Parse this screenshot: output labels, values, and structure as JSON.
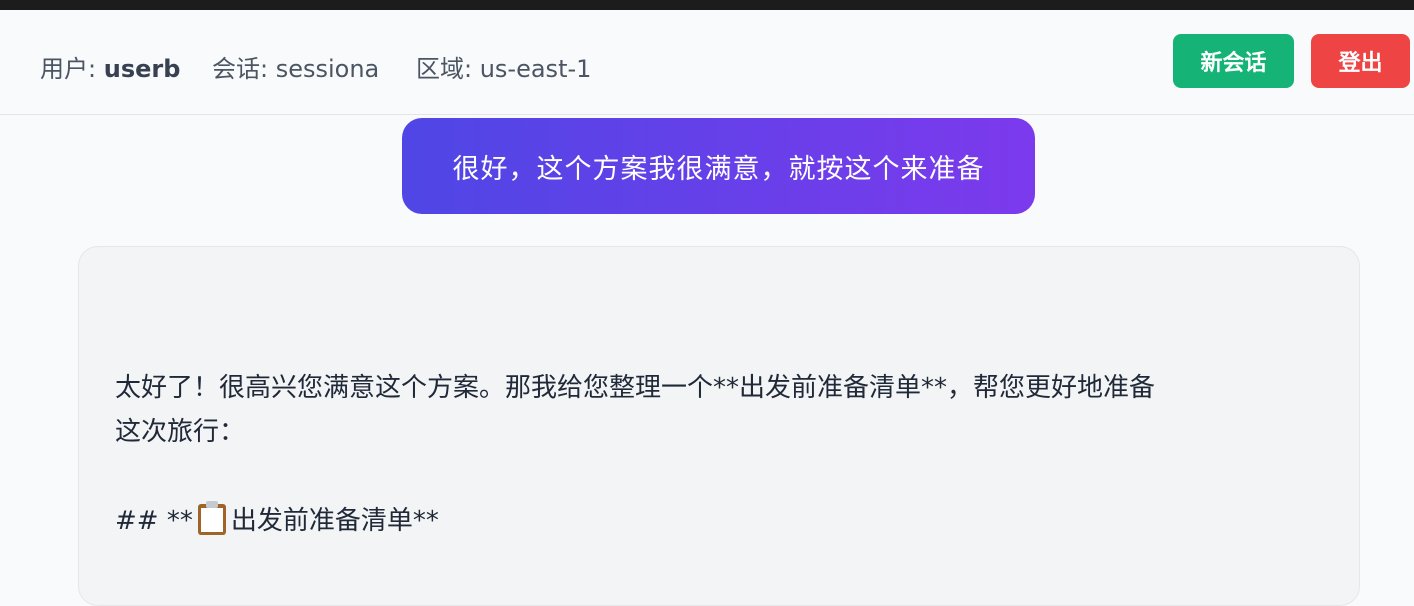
{
  "header": {
    "user_label": "用户:",
    "user_value": "userb",
    "session_text": "会话: sessiona",
    "region_text": "区域: us-east-1",
    "new_session_label": "新会话",
    "logout_label": "登出"
  },
  "colors": {
    "new_session_button": "#16b377",
    "logout_button": "#ef4444",
    "user_bubble_gradient_start": "#4f46e5",
    "user_bubble_gradient_end": "#7c3aed"
  },
  "chat": {
    "user_message": "很好，这个方案我很满意，就按这个来准备",
    "assistant_lines": [
      "太好了！很高兴您满意这个方案。那我给您整理一个**出发前准备清单**，帮您更好地准备",
      "这次旅行：",
      "## **",
      "出发前准备清单**"
    ],
    "assistant_icon": "clipboard-icon"
  }
}
